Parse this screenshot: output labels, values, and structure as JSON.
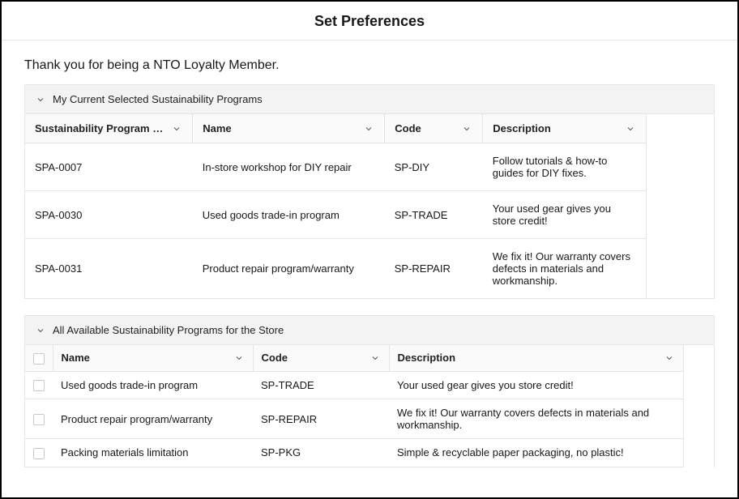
{
  "header": {
    "title": "Set Preferences"
  },
  "thankyou": "Thank you for being a NTO Loyalty Member.",
  "section1": {
    "title": "My Current Selected Sustainability Programs",
    "columns": {
      "c0": "Sustainability Program …",
      "c1": "Name",
      "c2": "Code",
      "c3": "Description"
    },
    "rows": [
      {
        "c0": "SPA-0007",
        "c1": "In-store workshop for DIY repair",
        "c2": "SP-DIY",
        "c3": "Follow tutorials & how-to guides for DIY fixes."
      },
      {
        "c0": "SPA-0030",
        "c1": "Used goods trade-in program",
        "c2": "SP-TRADE",
        "c3": "Your used gear gives you store credit!"
      },
      {
        "c0": "SPA-0031",
        "c1": "Product repair program/warranty",
        "c2": "SP-REPAIR",
        "c3": "We fix it! Our warranty covers defects in materials and workmanship."
      }
    ]
  },
  "section2": {
    "title": "All Available Sustainability Programs for the Store",
    "columns": {
      "c0": "Name",
      "c1": "Code",
      "c2": "Description"
    },
    "rows": [
      {
        "c0": "Used goods trade-in program",
        "c1": "SP-TRADE",
        "c2": "Your used gear gives you store credit!"
      },
      {
        "c0": "Product repair program/warranty",
        "c1": "SP-REPAIR",
        "c2": "We fix it! Our warranty covers defects in materials and workmanship."
      },
      {
        "c0": "Packing materials limitation",
        "c1": "SP-PKG",
        "c2": "Simple & recyclable paper packaging, no plastic!"
      }
    ]
  }
}
